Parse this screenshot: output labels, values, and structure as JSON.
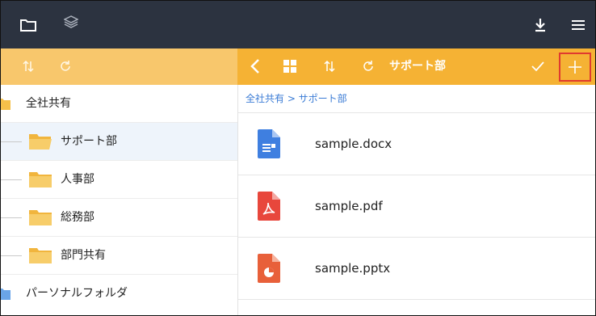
{
  "topbar": {
    "left_icons": [
      "folder-icon",
      "layers-icon"
    ],
    "right_icons": [
      "download-icon",
      "menu-icon"
    ]
  },
  "toolbar": {
    "left_icons": [
      "sort-icon",
      "refresh-icon"
    ],
    "right_icons": [
      "back-chevron-icon",
      "grid-view-icon",
      "sort-icon",
      "refresh-icon"
    ],
    "current_folder": "サポート部",
    "check_icon": "check-icon",
    "add_icon": "plus-icon",
    "accent_color": "#f5b234",
    "highlight_color": "#e03a2f"
  },
  "sidebar": {
    "items": [
      {
        "label": "全社共有",
        "icon": "shared-folder-icon",
        "level": "root",
        "selected": false
      },
      {
        "label": "サポート部",
        "icon": "folder-icon",
        "level": "child",
        "selected": true
      },
      {
        "label": "人事部",
        "icon": "folder-icon",
        "level": "child",
        "selected": false
      },
      {
        "label": "総務部",
        "icon": "folder-icon",
        "level": "child",
        "selected": false
      },
      {
        "label": "部門共有",
        "icon": "folder-icon",
        "level": "child",
        "selected": false
      },
      {
        "label": "パーソナルフォルダ",
        "icon": "personal-folder-icon",
        "level": "root",
        "selected": false
      }
    ]
  },
  "main": {
    "breadcrumb": "全社共有 > サポート部",
    "files": [
      {
        "name": "sample.docx",
        "icon": "docx-file-icon",
        "color": "#3f7fe0"
      },
      {
        "name": "sample.pdf",
        "icon": "pdf-file-icon",
        "color": "#e8473c"
      },
      {
        "name": "sample.pptx",
        "icon": "pptx-file-icon",
        "color": "#e8603a"
      }
    ]
  }
}
